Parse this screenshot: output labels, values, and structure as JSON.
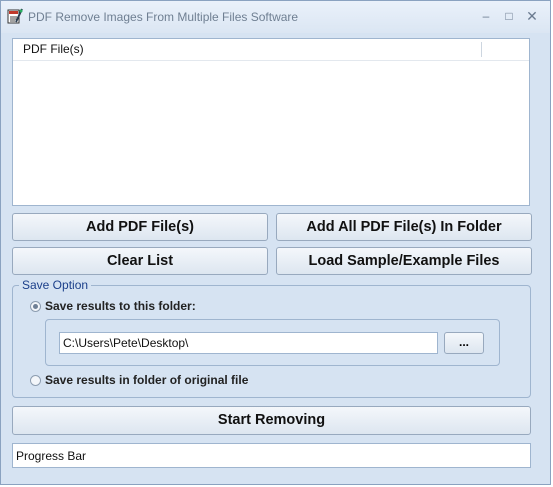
{
  "window": {
    "title": "PDF Remove Images From Multiple Files Software",
    "controls": {
      "minimize": "–",
      "maximize": "□",
      "close": "✕"
    }
  },
  "file_list": {
    "column_header": "PDF File(s)",
    "items": []
  },
  "buttons": {
    "add_pdf": "Add PDF File(s)",
    "add_all_folder": "Add All PDF File(s) In Folder",
    "clear_list": "Clear List",
    "load_sample": "Load Sample/Example Files",
    "start": "Start Removing",
    "browse": "..."
  },
  "save_option": {
    "label": "Save Option",
    "to_folder_label": "Save results to this folder:",
    "folder_path": "C:\\Users\\Pete\\Desktop\\",
    "original_folder_label": "Save results in folder of original file",
    "selected": "to_folder"
  },
  "progress": {
    "label": "Progress Bar",
    "value": 0
  },
  "icons": {
    "app": "pdf-edit-icon"
  }
}
